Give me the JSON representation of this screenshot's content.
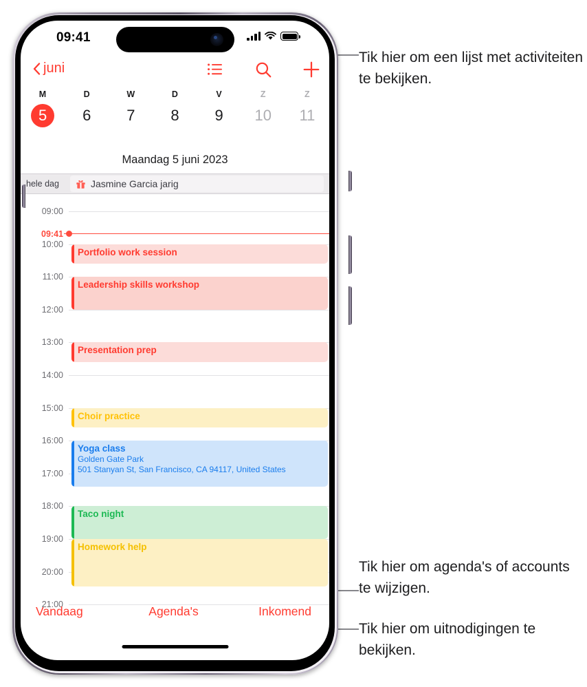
{
  "status_bar": {
    "time": "09:41",
    "signal_icon": "cellular-bars-icon",
    "wifi_icon": "wifi-icon",
    "battery_icon": "battery-icon"
  },
  "navbar": {
    "back_label": "juni",
    "back_icon": "chevron-left-icon",
    "list_icon": "list-view-icon",
    "search_icon": "search-icon",
    "add_icon": "plus-icon"
  },
  "week_strip": {
    "days": [
      {
        "dow": "M",
        "num": "5",
        "selected": true,
        "dim": false
      },
      {
        "dow": "D",
        "num": "6",
        "selected": false,
        "dim": false
      },
      {
        "dow": "W",
        "num": "7",
        "selected": false,
        "dim": false
      },
      {
        "dow": "D",
        "num": "8",
        "selected": false,
        "dim": false
      },
      {
        "dow": "V",
        "num": "9",
        "selected": false,
        "dim": false
      },
      {
        "dow": "Z",
        "num": "10",
        "selected": false,
        "dim": true
      },
      {
        "dow": "Z",
        "num": "11",
        "selected": false,
        "dim": true
      }
    ]
  },
  "date_title": "Maandag 5 juni 2023",
  "all_day": {
    "label": "hele dag",
    "event_title": "Jasmine Garcia jarig",
    "event_icon": "gift-icon"
  },
  "timeline": {
    "hours": [
      "09:00",
      "10:00",
      "11:00",
      "12:00",
      "13:00",
      "14:00",
      "15:00",
      "16:00",
      "17:00",
      "18:00",
      "19:00",
      "20:00",
      "21:00"
    ],
    "current_time_label": "09:41"
  },
  "events": [
    {
      "title": "Portfolio work session",
      "sub1": "",
      "sub2": "",
      "color": "#ff3b30",
      "bg": "#fcdcd9",
      "start": 10.0,
      "end": 10.6
    },
    {
      "title": "Leadership skills workshop",
      "sub1": "",
      "sub2": "",
      "color": "#ff3b30",
      "bg": "#fbd2cd",
      "start": 11.0,
      "end": 12.0
    },
    {
      "title": "Presentation prep",
      "sub1": "",
      "sub2": "",
      "color": "#ff3b30",
      "bg": "#fcdcd9",
      "start": 13.0,
      "end": 13.6
    },
    {
      "title": "Choir practice",
      "sub1": "",
      "sub2": "",
      "color": "#ffc107",
      "bg": "#fdf0c4",
      "start": 15.0,
      "end": 15.6
    },
    {
      "title": "Yoga class",
      "sub1": "Golden Gate Park",
      "sub2": "501 Stanyan St, San Francisco, CA 94117, United States",
      "color": "#1a7ded",
      "bg": "#cfe4fb",
      "start": 16.0,
      "end": 17.4
    },
    {
      "title": "Taco night",
      "sub1": "",
      "sub2": "",
      "color": "#1db954",
      "bg": "#cdeed5",
      "start": 18.0,
      "end": 19.0
    },
    {
      "title": "Homework help",
      "sub1": "",
      "sub2": "",
      "color": "#f5c000",
      "bg": "#fdf0c4",
      "start": 19.0,
      "end": 20.45
    }
  ],
  "toolbar": {
    "today_label": "Vandaag",
    "calendars_label": "Agenda's",
    "inbox_label": "Inkomend"
  },
  "callouts": {
    "list": "Tik hier om een lijst met activiteiten te bekijken.",
    "calendars": "Tik hier om agenda's of accounts te wijzigen.",
    "inbox": "Tik hier om uitnodigingen te bekijken."
  },
  "colors": {
    "accent": "#ff3b30",
    "now_indicator": "#ff4b3e",
    "callout_line": "#86868b"
  }
}
